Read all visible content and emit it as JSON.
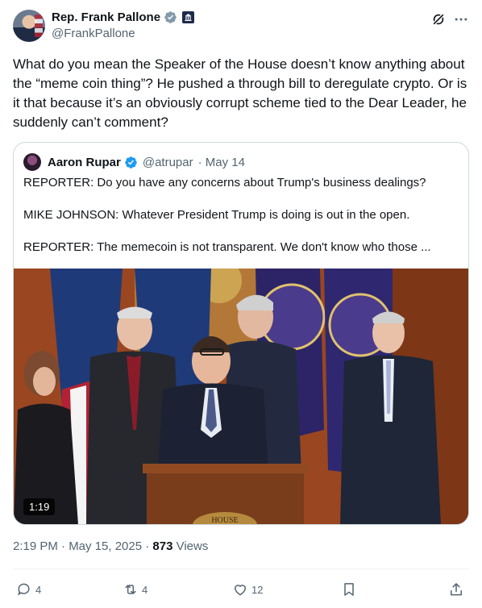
{
  "author": {
    "name": "Rep. Frank Pallone",
    "handle": "@FrankPallone",
    "avatar_icon": "profile-photo"
  },
  "tweet": {
    "text": "What do you mean the Speaker of the House doesn’t know anything about the “meme coin thing”? He pushed a through bill to deregulate crypto. Or is it that because it’s an obviously corrupt scheme tied to the Dear Leader, he suddenly can’t comment?"
  },
  "quote": {
    "name": "Aaron Rupar",
    "handle": "@atrupar",
    "date": "· May 14",
    "lines": [
      "REPORTER: Do you have any concerns about Trump's business dealings?",
      "MIKE JOHNSON: Whatever President Trump is doing is out in the open.",
      "REPORTER: The memecoin is not transparent. We don't know who those ..."
    ],
    "video_duration": "1:19",
    "podium_text": "HOUSE"
  },
  "meta": {
    "time": "2:19 PM · May 15, 2025 · ",
    "views_count": "873",
    "views_label": " Views"
  },
  "actions": {
    "replies": "4",
    "reposts": "4",
    "likes": "12"
  },
  "colors": {
    "verified": "#1d9bf0",
    "text": "#0f1419",
    "secondary": "#536471",
    "border": "#cfd9de"
  }
}
